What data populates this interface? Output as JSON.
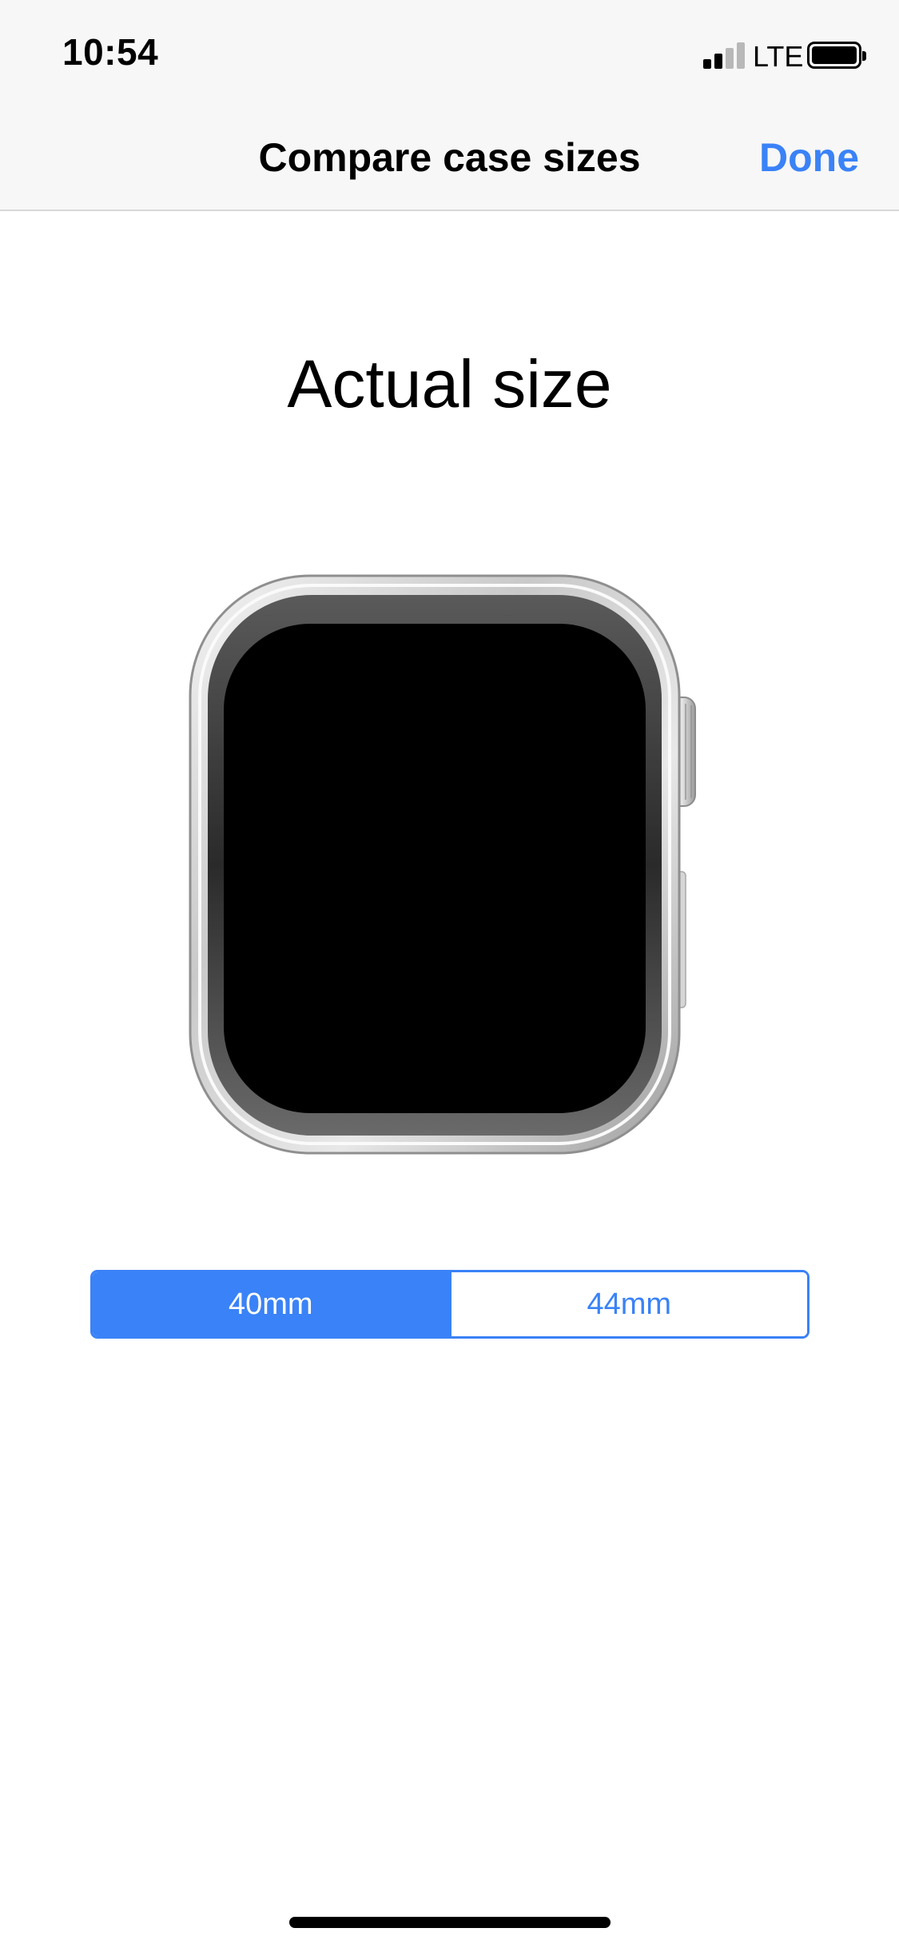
{
  "status_bar": {
    "time": "10:54",
    "network": "LTE",
    "icons": [
      "cellular-signal-icon",
      "battery-icon"
    ],
    "signal_bars_active": 2,
    "signal_bars_total": 4,
    "battery_level": 1.0
  },
  "nav": {
    "title": "Compare case sizes",
    "done_label": "Done"
  },
  "main": {
    "heading": "Actual size",
    "image": "apple-watch-case-image"
  },
  "size_selector": {
    "options": [
      {
        "label": "40mm",
        "selected": true
      },
      {
        "label": "44mm",
        "selected": false
      }
    ]
  },
  "colors": {
    "accent": "#3a82f7",
    "nav_background": "#f7f7f7",
    "page_background": "#ffffff"
  }
}
